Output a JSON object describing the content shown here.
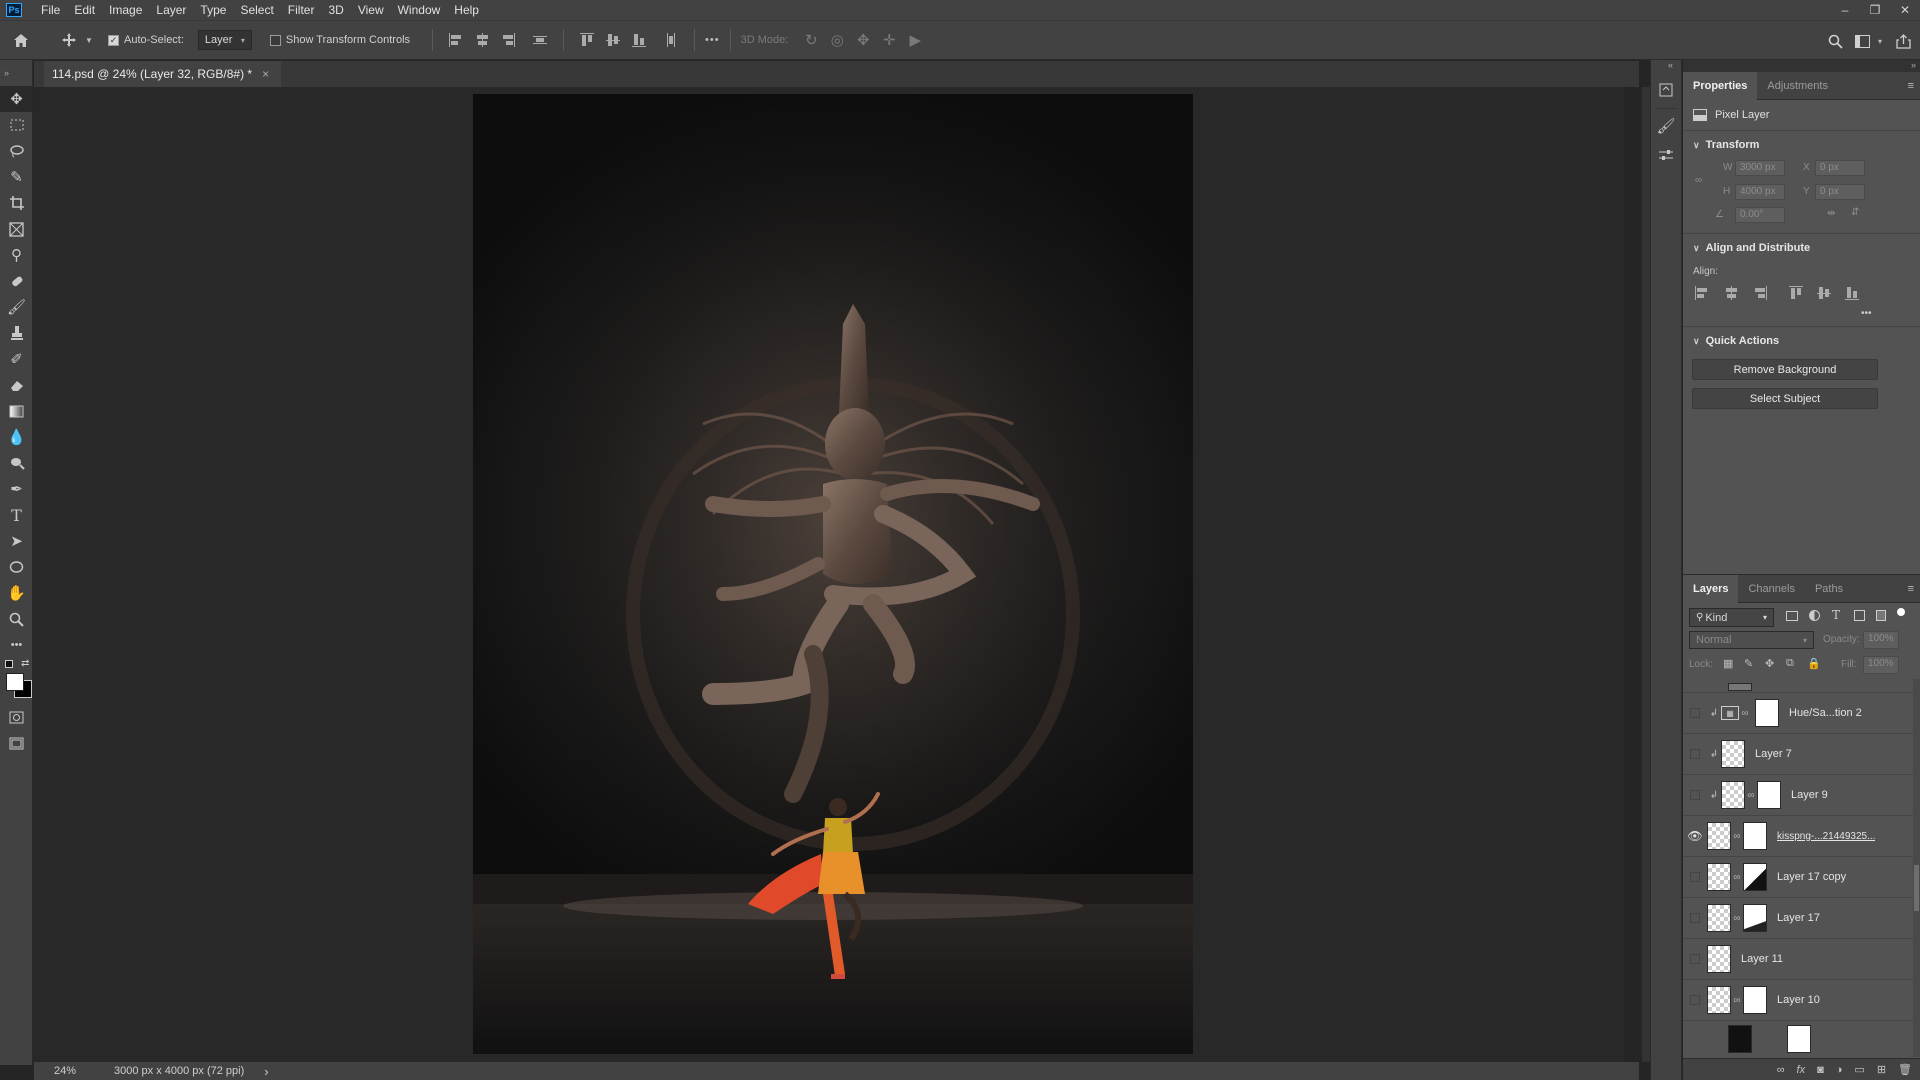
{
  "app": {
    "logo": "Ps"
  },
  "menu": [
    "File",
    "Edit",
    "Image",
    "Layer",
    "Type",
    "Select",
    "Filter",
    "3D",
    "View",
    "Window",
    "Help"
  ],
  "window_controls": {
    "minimize": "–",
    "restore": "❐",
    "close": "✕"
  },
  "options": {
    "auto_select_label": "Auto-Select:",
    "auto_select_target": "Layer",
    "show_transform_label": "Show Transform Controls",
    "more": "•••",
    "mode_3d_label": "3D Mode:"
  },
  "document": {
    "tab_title": "114.psd @ 24% (Layer 32, RGB/8#) *",
    "close": "×"
  },
  "status": {
    "zoom": "24%",
    "doc_size": "3000 px x 4000 px (72 ppi)",
    "arrow": "›"
  },
  "properties": {
    "tabs": [
      "Properties",
      "Adjustments"
    ],
    "kind": "Pixel Layer",
    "transform": {
      "title": "Transform",
      "w_label": "W",
      "w": "3000 px",
      "x_label": "X",
      "x": "0 px",
      "h_label": "H",
      "h": "4000 px",
      "y_label": "Y",
      "y": "0 px",
      "angle": "0.00°"
    },
    "align": {
      "title": "Align and Distribute",
      "label": "Align:",
      "more": "•••"
    },
    "quick_actions": {
      "title": "Quick Actions",
      "remove_bg": "Remove Background",
      "select_subject": "Select Subject"
    }
  },
  "layers": {
    "tabs": [
      "Layers",
      "Channels",
      "Paths"
    ],
    "filter": "Kind",
    "blend_mode": "Normal",
    "opacity_label": "Opacity:",
    "opacity": "100%",
    "lock_label": "Lock:",
    "fill_label": "Fill:",
    "fill": "100%",
    "items": [
      {
        "name": "Hue/Sa...tion 2",
        "visible": false
      },
      {
        "name": "Layer 7",
        "visible": false
      },
      {
        "name": "Layer 9",
        "visible": false
      },
      {
        "name": "kisspng-...21449325...",
        "visible": true
      },
      {
        "name": "Layer 17 copy",
        "visible": false
      },
      {
        "name": "Layer 17",
        "visible": false
      },
      {
        "name": "Layer 11",
        "visible": false
      },
      {
        "name": "Layer 10",
        "visible": false
      }
    ]
  },
  "colors": {
    "accent": "#31a8ff",
    "panel": "#535353",
    "canvas_bg": "#282828",
    "chrome": "#424242"
  }
}
